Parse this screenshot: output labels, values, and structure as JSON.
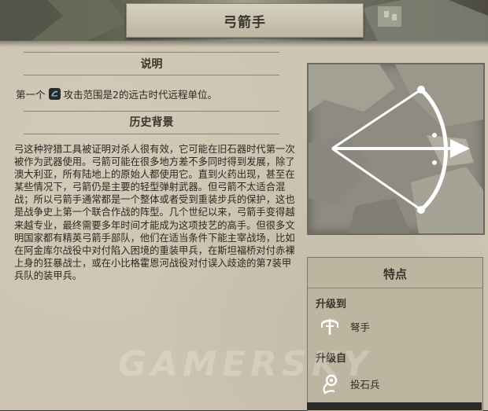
{
  "header": {
    "title": "弓箭手"
  },
  "description": {
    "heading": "说明",
    "prefix": "第一个",
    "icon": "ranged-unit-icon",
    "text": "攻击范围是2的远古时代远程单位。"
  },
  "history": {
    "heading": "历史背景",
    "body": "弓这种狩猎工具被证明对杀人很有效，它可能在旧石器时代第一次被作为武器使用。弓箭可能在很多地方差不多同时得到发展，除了澳大利亚，所有陆地上的原始人都使用它。直到火药出现，甚至在某些情况下，弓箭仍是主要的轻型弹射武器。但弓箭不太适合混战；所以弓箭手通常都是一个整体或者受到重装步兵的保护，这也是战争史上第一个联合作战的阵型。几个世纪以来，弓箭手变得越来越专业，最终需要多年时间才能成为这项技艺的高手。但很多文明国家都有精英弓箭手部队，他们在适当条件下能主宰战场，比如在阿金库尔战役中对付陷入困境的重装甲兵，在斯坦福桥对付赤裸上身的狂暴战士，或在小比格霍恩河战役对付误入歧途的第7装甲兵队的装甲兵。"
  },
  "features": {
    "heading": "特点",
    "upgrade_to_label": "升级到",
    "upgrade_to": {
      "name": "弩手",
      "icon": "crossbow-icon"
    },
    "upgrade_from_label": "升级自",
    "upgrade_from": {
      "name": "投石兵",
      "icon": "sling-icon"
    }
  },
  "illustration": {
    "icon": "bow-and-arrow-icon"
  },
  "watermark": "GAMERSKY"
}
